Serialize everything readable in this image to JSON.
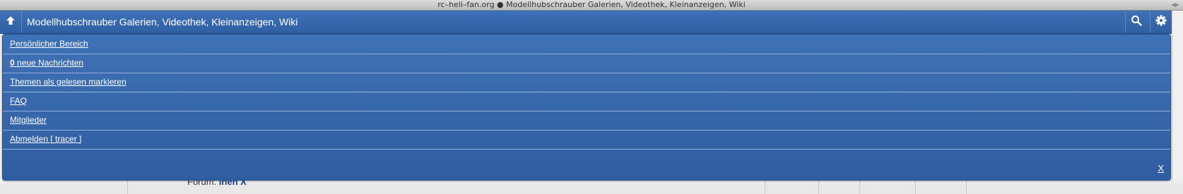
{
  "window": {
    "title": "rc–heli–fan.org ● Modellhubschrauber Galerien, Videothek, Kleinanzeigen, Wiki",
    "resize_glyph": "⟛"
  },
  "background": {
    "partial_text_prefix": "Forum:",
    "partial_text_bold": "Ineh X"
  },
  "header": {
    "title": "Modellhubschrauber Galerien, Videothek, Kleinanzeigen, Wiki",
    "icons": [
      "arrow-up-icon",
      "search-icon",
      "gear-icon"
    ]
  },
  "menu": {
    "items": [
      {
        "label": "Persönlicher Bereich"
      },
      {
        "count": "0",
        "label": " neue Nachrichten"
      },
      {
        "label": "Themen als gelesen markieren"
      },
      {
        "label": "FAQ"
      },
      {
        "label": "Mitglieder"
      },
      {
        "label": "Abmelden [ tracer ]"
      }
    ],
    "close_label": "X"
  },
  "colors": {
    "header_blue": "#3f71b6",
    "menu_blue": "#3f72b5",
    "divider": "#8fb0dd",
    "text": "#ffffff"
  }
}
